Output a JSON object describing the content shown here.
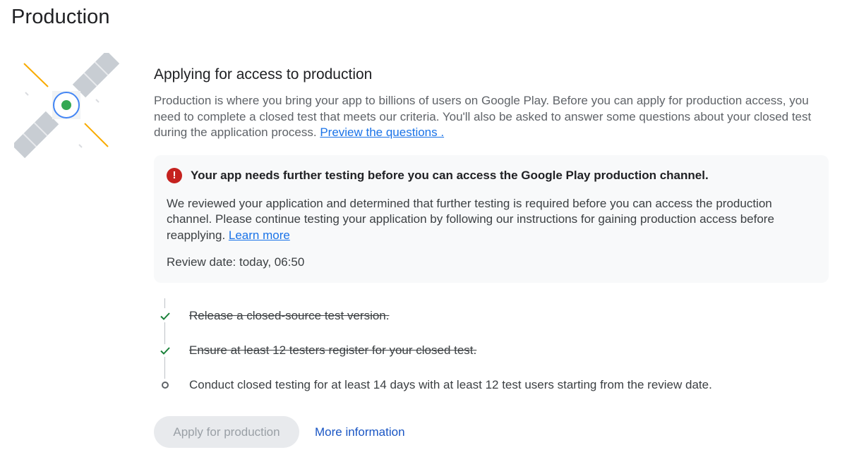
{
  "page": {
    "title": "Production"
  },
  "section": {
    "title": "Applying for access to production",
    "intro_text": "Production is where you bring your app to billions of users on Google Play. Before you can apply for production access, you need to complete a closed test that meets our criteria. You'll also be asked to answer some questions about your closed test during the application process. ",
    "intro_link": "Preview the questions ."
  },
  "alert": {
    "icon": "error-icon",
    "title": "Your app needs further testing before you can access the Google Play production channel.",
    "body_text": "We reviewed your application and determined that further testing is required before you can access the production channel. Please continue testing your application by following our instructions for gaining production access before reapplying. ",
    "body_link": "Learn more",
    "review_date": "Review date: today, 06:50"
  },
  "steps": [
    {
      "label": "Release a closed-source test version.",
      "status": "done"
    },
    {
      "label": "Ensure at least 12 testers register for your closed test.",
      "status": "done"
    },
    {
      "label": "Conduct closed testing for at least 14 days with at least 12 test users starting from the review date.",
      "status": "pending"
    }
  ],
  "actions": {
    "apply_label": "Apply for production",
    "more_label": "More information"
  },
  "colors": {
    "accent_link": "#1a73e8",
    "error": "#c5221f",
    "check": "#188038"
  }
}
